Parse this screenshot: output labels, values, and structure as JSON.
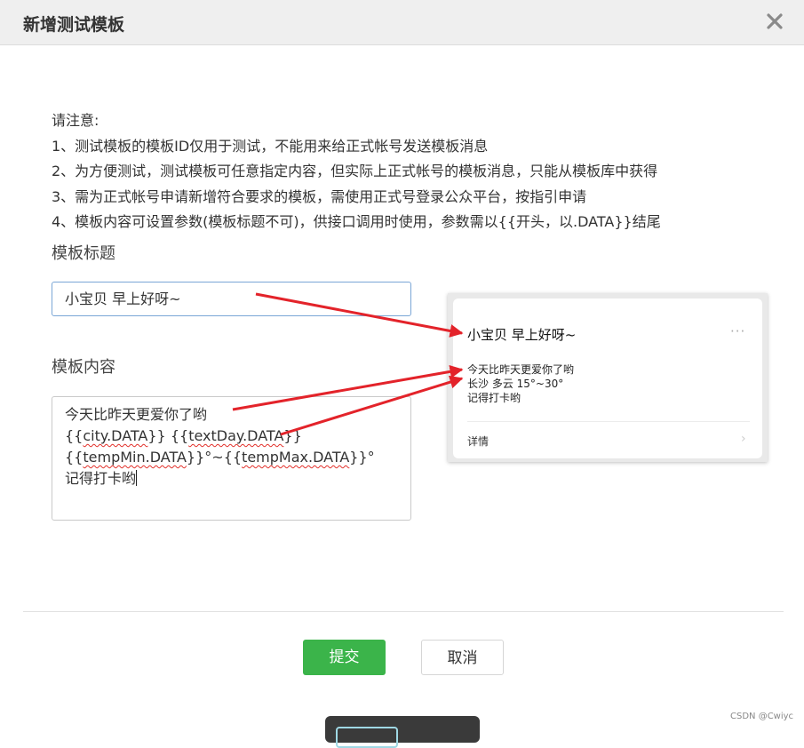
{
  "dialog": {
    "title": "新增测试模板",
    "close_icon": "close-icon"
  },
  "notes": {
    "heading": "请注意:",
    "items": [
      "1、测试模板的模板ID仅用于测试，不能用来给正式帐号发送模板消息",
      "2、为方便测试，测试模板可任意指定内容，但实际上正式帐号的模板消息，只能从模板库中获得",
      "3、需为正式帐号申请新增符合要求的模板，需使用正式号登录公众平台，按指引申请",
      "4、模板内容可设置参数(模板标题不可)，供接口调用时使用，参数需以{{开头，以.DATA}}结尾"
    ]
  },
  "form": {
    "title_label": "模板标题",
    "title_value": "小宝贝 早上好呀~",
    "content_label": "模板内容",
    "content_lines": {
      "line1": "今天比昨天更爱你了哟",
      "line2_a": "{{",
      "line2_b": "city.DATA",
      "line2_c": "}} {{",
      "line2_d": "textDay.DATA",
      "line2_e": "}}",
      "line3_a": "{{",
      "line3_b": "tempMin.DATA",
      "line3_c": "}}°~{{",
      "line3_d": "tempMax.DATA",
      "line3_e": "}}°",
      "line4": "记得打卡哟"
    }
  },
  "preview": {
    "title": "小宝贝 早上好呀~",
    "more_icon": "···",
    "lines": [
      "今天比昨天更爱你了哟",
      "长沙 多云 15°~30°",
      "记得打卡哟"
    ],
    "detail": "详情",
    "chevron": "›"
  },
  "buttons": {
    "submit": "提交",
    "cancel": "取消"
  },
  "watermark": "CSDN @Cwiyc",
  "colors": {
    "submit_bg": "#3bb44a",
    "arrow": "#e3232a",
    "input_focus_border": "#7aa6d6"
  }
}
